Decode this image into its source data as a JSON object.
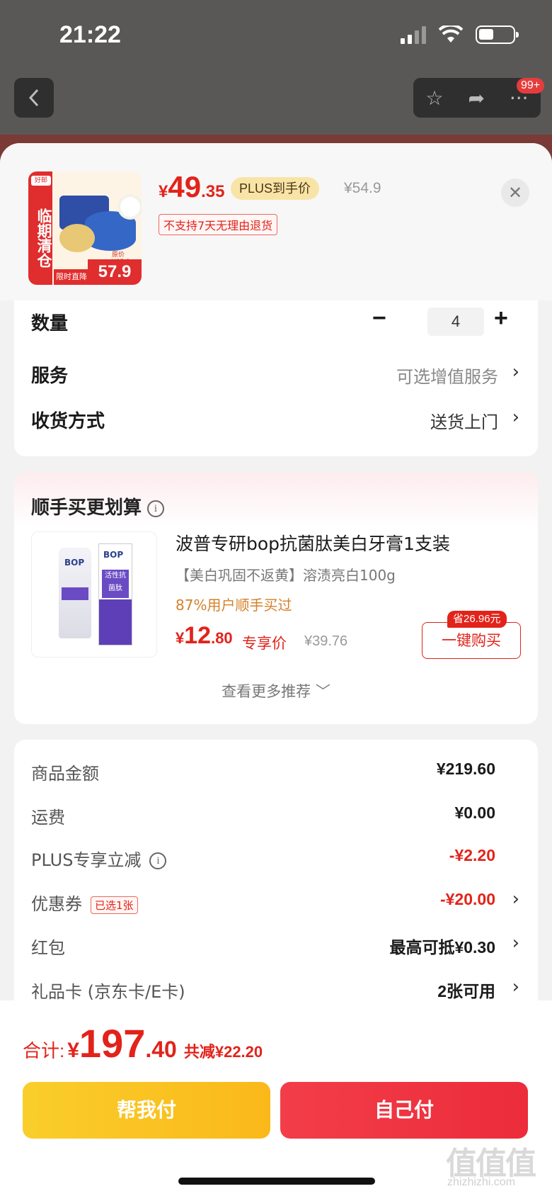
{
  "status": {
    "time": "21:22"
  },
  "nav": {
    "badge": "99+"
  },
  "product": {
    "price_currency": "¥",
    "price_int": "49",
    "price_dec": ".35",
    "plus_tag": "PLUS到手价",
    "original_price": "¥54.9",
    "return_policy": "不支持7天无理由退货",
    "thumb_side_text": "临期清仓",
    "thumb_brand": "好邮",
    "thumb_price": "57.9",
    "thumb_note": "限时直降",
    "thumb_orig": "原价¥85.9"
  },
  "options": {
    "quantity_label": "数量",
    "quantity_value": "4",
    "service_label": "服务",
    "service_value": "可选增值服务",
    "delivery_label": "收货方式",
    "delivery_value": "送货上门"
  },
  "recommend": {
    "title": "顺手买更划算",
    "item": {
      "name": "波普专研bop抗菌肽美白牙膏1支装",
      "subtitle": "【美白巩固不返黄】溶渍亮白100g",
      "buyers": "87%用户顺手买过",
      "price_currency": "¥",
      "price_int": "12",
      "price_dec": ".80",
      "exclusive_label": "专享价",
      "original_price": "¥39.76",
      "save_tag": "省26.96元",
      "buy_button": "一键购买",
      "tube_label": "BOP",
      "box_label": "BOP",
      "box_band": "活性抗菌肽"
    },
    "more": "查看更多推荐"
  },
  "summary": {
    "rows": [
      {
        "label": "商品金额",
        "value": "¥219.60"
      },
      {
        "label": "运费",
        "value": "¥0.00"
      },
      {
        "label": "PLUS专享立减",
        "value": "-¥2.20"
      },
      {
        "label": "优惠券",
        "tag": "已选1张",
        "value": "-¥20.00"
      },
      {
        "label": "红包",
        "value": "最高可抵¥0.30"
      },
      {
        "label": "礼品卡 (京东卡/E卡)",
        "value": "2张可用"
      }
    ]
  },
  "footer": {
    "total_label": "合计:",
    "total_currency": "¥",
    "total_int": "197",
    "total_dec": ".40",
    "total_reduce": "共减¥22.20",
    "pay_help": "帮我付",
    "pay_self": "自己付"
  },
  "watermark": {
    "main": "值值值",
    "sub": "zhizhizhi.com"
  },
  "colors": {
    "accent": "#e2231a",
    "plus_bg": "#f9e4a8",
    "help_btn": "#f9ce2b",
    "self_btn": "#f33d49"
  }
}
